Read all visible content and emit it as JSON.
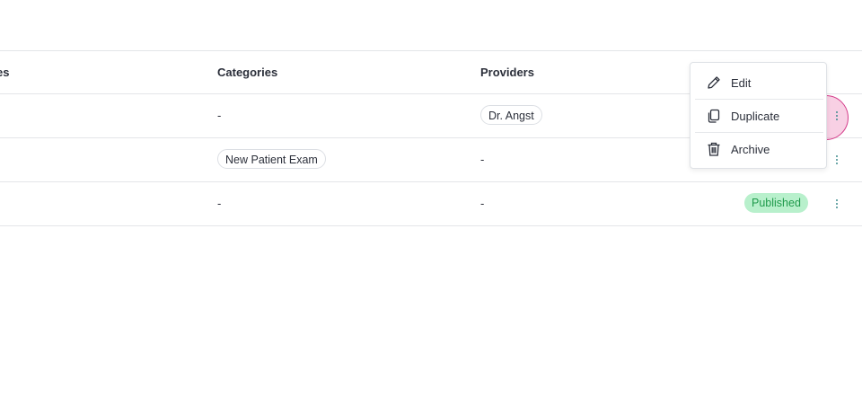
{
  "table": {
    "headers": {
      "name_partial": "es",
      "categories": "Categories",
      "providers": "Providers"
    },
    "rows": [
      {
        "category": "-",
        "provider": "Dr. Angst",
        "status": ""
      },
      {
        "category": "New Patient Exam",
        "provider": "-",
        "status": ""
      },
      {
        "category": "-",
        "provider": "-",
        "status": "Published"
      }
    ]
  },
  "menu": {
    "items": [
      {
        "label": "Edit",
        "icon": "pencil-icon"
      },
      {
        "label": "Duplicate",
        "icon": "copy-icon"
      },
      {
        "label": "Archive",
        "icon": "trash-icon"
      }
    ]
  },
  "colors": {
    "published_bg": "#b8f0cc",
    "published_text": "#1f9a4c",
    "kebab": "#3f8c8e",
    "click_highlight": "#d43c8a"
  }
}
